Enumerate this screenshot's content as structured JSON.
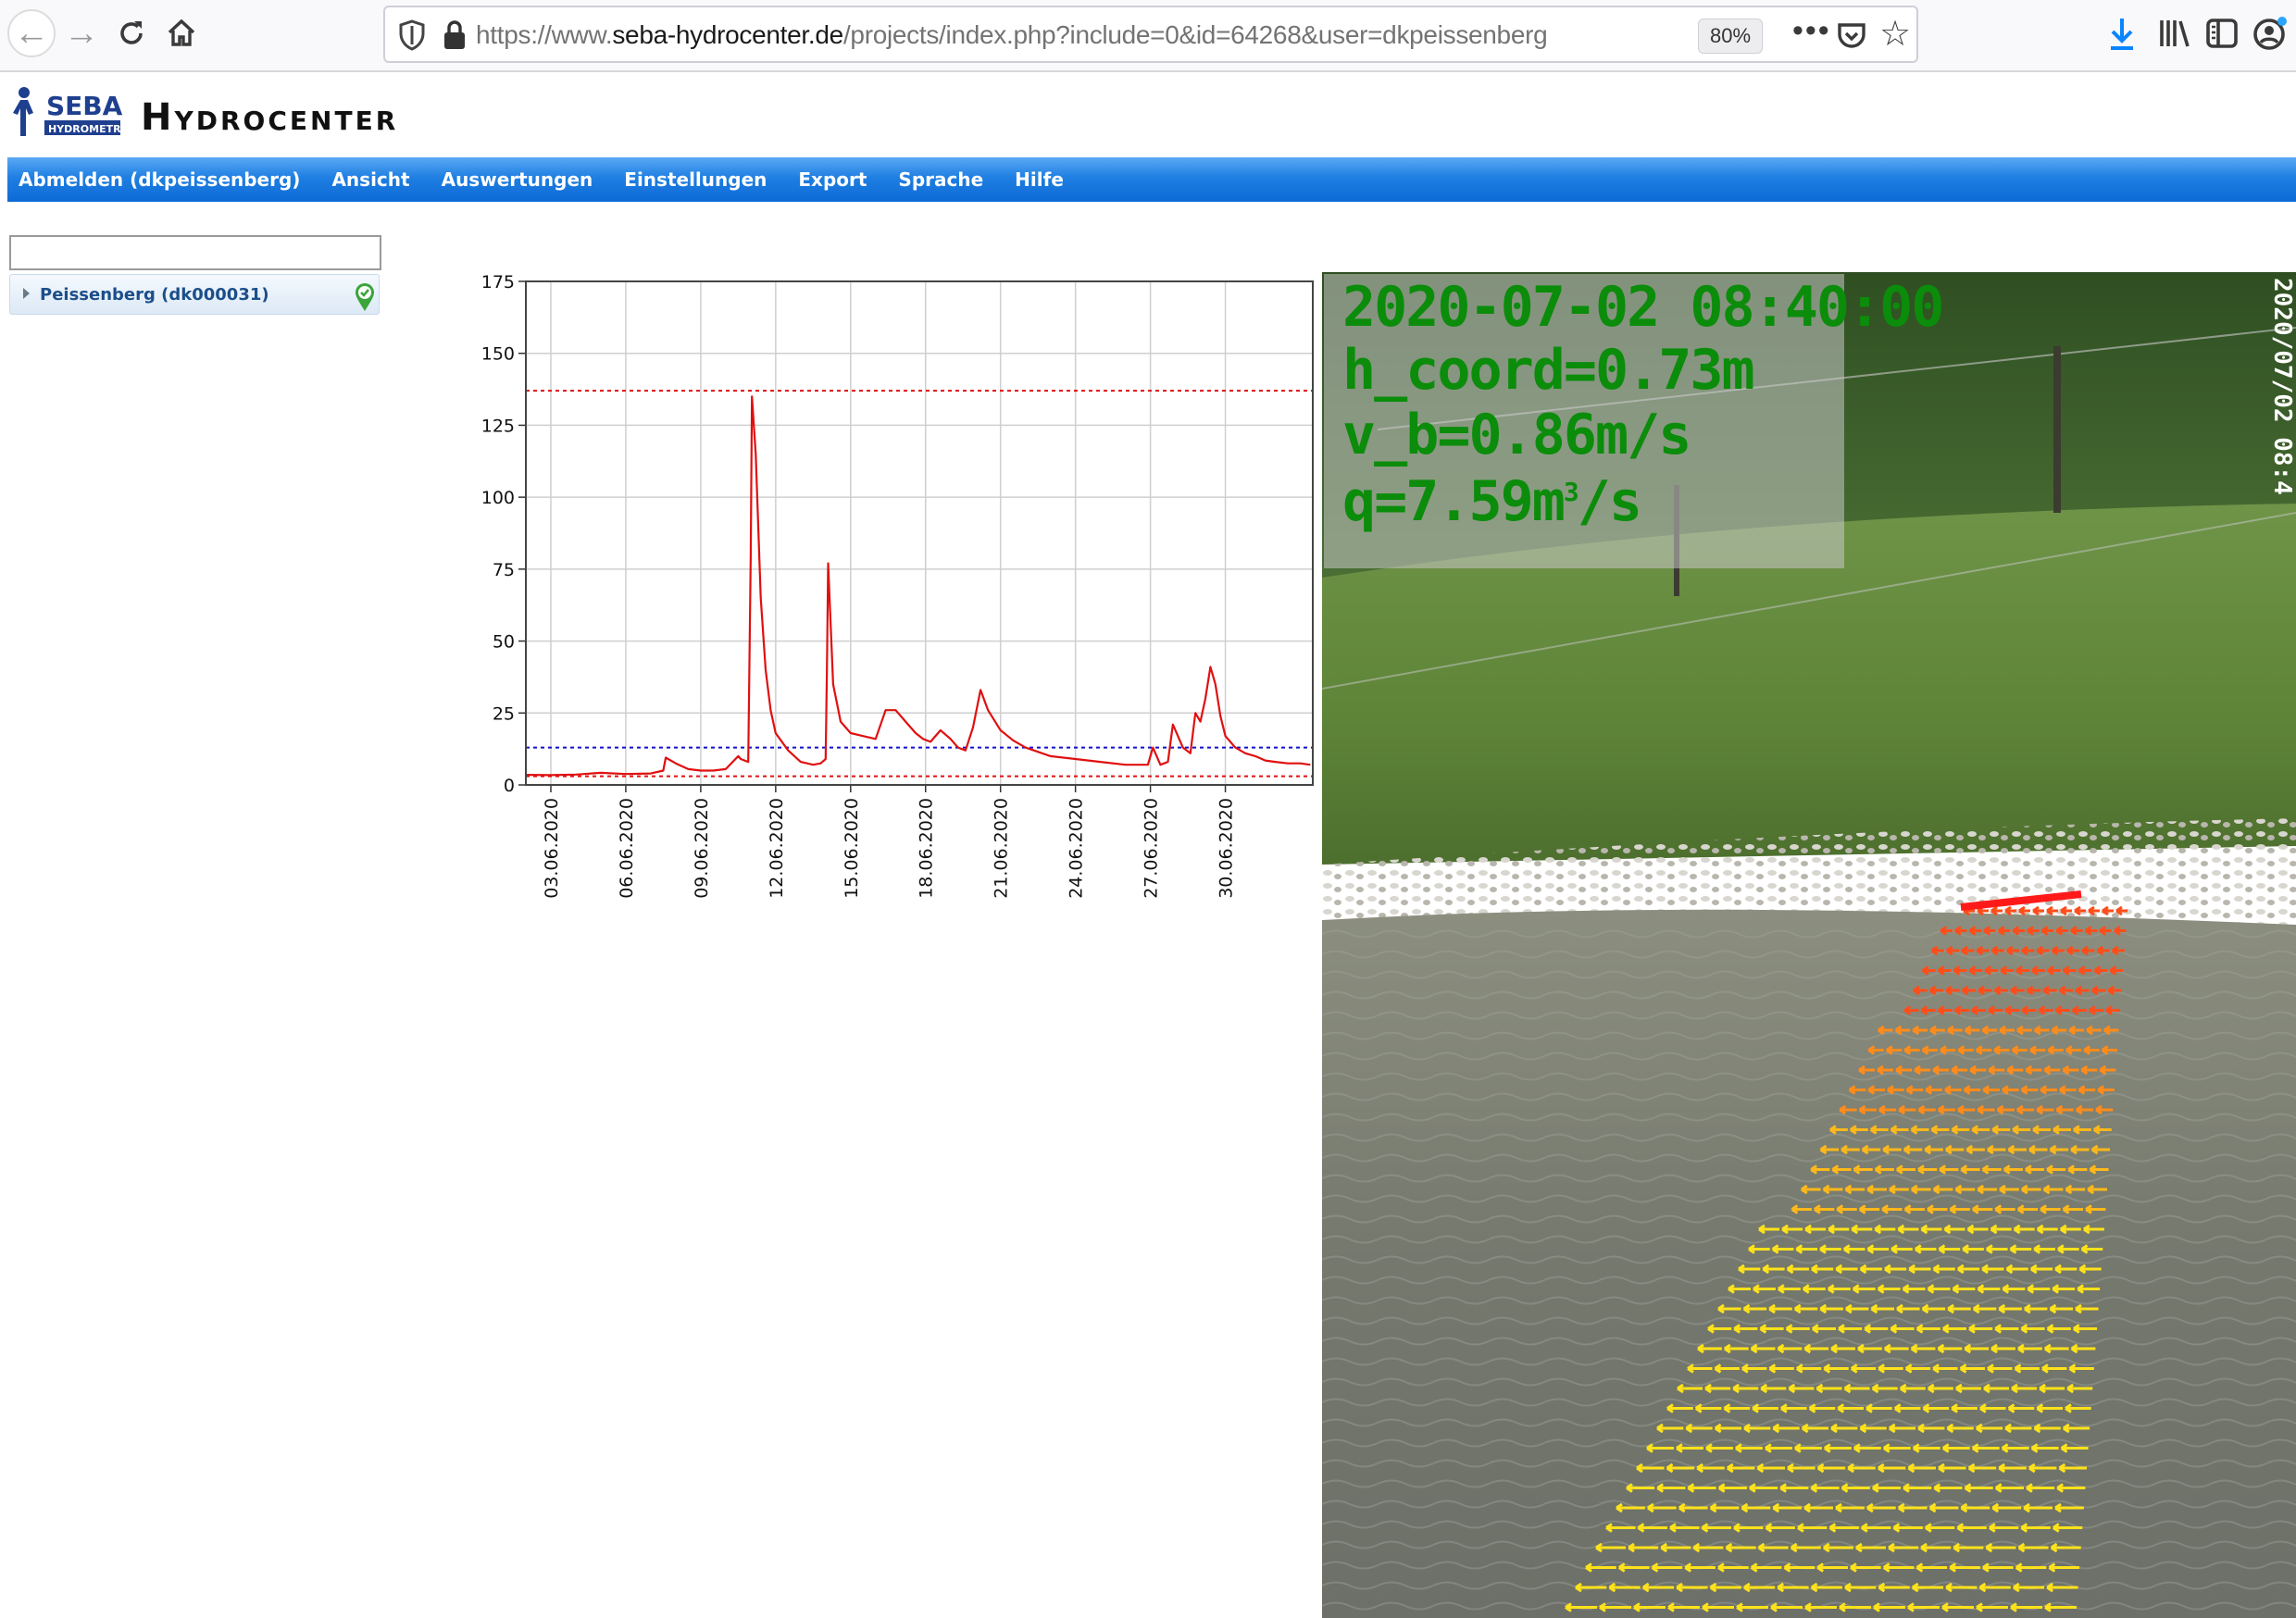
{
  "browser": {
    "url_prefix": "https://www.",
    "url_host": "seba-hydrocenter.de",
    "url_path": "/projects/index.php?include=0&id=64268&user=dkpeissenberg",
    "zoom": "80%",
    "more": "•••"
  },
  "app": {
    "logo_text": "SEBA",
    "logo_subtext": "HYDROMETRIE",
    "title": "Hydrocenter"
  },
  "menu": {
    "items": [
      "Abmelden (dkpeissenberg)",
      "Ansicht",
      "Auswertungen",
      "Einstellungen",
      "Export",
      "Sprache",
      "Hilfe"
    ]
  },
  "tree": {
    "search_value": "",
    "items": [
      {
        "label": "Peissenberg (dk000031)",
        "status": "ok"
      }
    ]
  },
  "chart_data": {
    "type": "line",
    "ylim": [
      0,
      175
    ],
    "yticks": [
      0,
      25,
      50,
      75,
      100,
      125,
      150,
      175
    ],
    "xlim": [
      2,
      33.5
    ],
    "xticks": [
      {
        "day": 3,
        "label": "03.06.2020"
      },
      {
        "day": 6,
        "label": "06.06.2020"
      },
      {
        "day": 9,
        "label": "09.06.2020"
      },
      {
        "day": 12,
        "label": "12.06.2020"
      },
      {
        "day": 15,
        "label": "15.06.2020"
      },
      {
        "day": 18,
        "label": "18.06.2020"
      },
      {
        "day": 21,
        "label": "21.06.2020"
      },
      {
        "day": 24,
        "label": "24.06.2020"
      },
      {
        "day": 27,
        "label": "27.06.2020"
      },
      {
        "day": 30,
        "label": "30.06.2020"
      }
    ],
    "grid": true,
    "series": [
      {
        "color": "#e01010",
        "x": [
          2,
          3,
          4,
          5,
          6,
          7,
          7.5,
          7.6,
          8,
          8.5,
          9,
          9.5,
          10,
          10.5,
          10.6,
          10.9,
          11.0,
          11.05,
          11.2,
          11.4,
          11.6,
          11.8,
          12,
          12.5,
          13,
          13.5,
          13.8,
          14,
          14.05,
          14.1,
          14.3,
          14.6,
          15,
          15.5,
          16,
          16.4,
          16.8,
          17.2,
          17.6,
          17.9,
          18.2,
          18.6,
          19,
          19.3,
          19.6,
          19.9,
          20.2,
          20.5,
          21,
          21.5,
          22,
          23,
          24,
          25,
          26,
          26.9,
          27.1,
          27.4,
          27.7,
          27.9,
          28.3,
          28.6,
          28.8,
          29,
          29.2,
          29.4,
          29.6,
          29.8,
          30,
          30.4,
          30.8,
          31.2,
          31.6,
          32,
          32.5,
          33,
          33.4
        ],
        "y": [
          3.5,
          3.4,
          3.6,
          4.2,
          3.8,
          4.0,
          5.0,
          9.5,
          7.5,
          5.5,
          5.0,
          5.0,
          5.5,
          10.0,
          9.0,
          8.0,
          80,
          135,
          115,
          65,
          40,
          26,
          18,
          12,
          8,
          7,
          7.5,
          9,
          40,
          77,
          35,
          22,
          18,
          17,
          16,
          26,
          26,
          22,
          18,
          16,
          15,
          19,
          16,
          13,
          12,
          20,
          33,
          26,
          19,
          15.5,
          13,
          10,
          9,
          8,
          7,
          7,
          13,
          7,
          8,
          21,
          13,
          11,
          25,
          22,
          30,
          41,
          35,
          24,
          17,
          13,
          11,
          10,
          8.5,
          8,
          7.5,
          7.5,
          7
        ]
      }
    ],
    "reference_lines": [
      {
        "value": 137,
        "color": "#e01010"
      },
      {
        "value": 13,
        "color": "#1010d0"
      },
      {
        "value": 3,
        "color": "#e01010"
      }
    ]
  },
  "camera": {
    "timestamp": "2020-07-02 08:40:00",
    "h_coord": "h_coord=0.73m",
    "v_b": "v_b=0.86m/s",
    "q_prefix": "q=7.59m",
    "q_sup": "3",
    "q_suffix": "/s",
    "vertical_text": "2020/07/02 08:4"
  }
}
